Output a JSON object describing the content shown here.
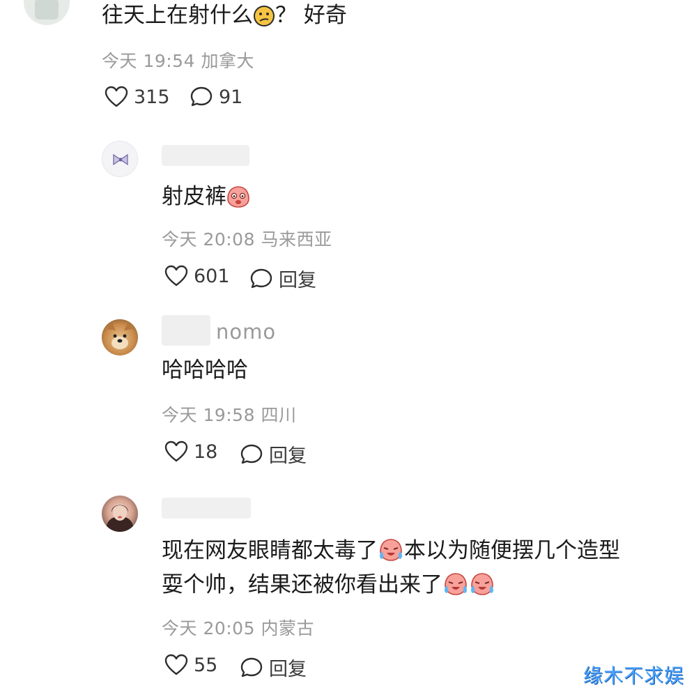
{
  "colors": {
    "text": "#1b1b1b",
    "meta": "#9a9a9a",
    "action": "#3a3a3a",
    "watermark": "#4aa0ff"
  },
  "comments": [
    {
      "text": "往天上在射什么",
      "text_after": "？ 好奇",
      "emoji": "confused-face-emoji",
      "meta": "今天 19:54 加拿大",
      "likes": "315",
      "replies": "91"
    },
    {
      "text": "射皮裤",
      "emoji": "blushing-face-emoji",
      "meta": "今天 20:08 马来西亚",
      "likes": "601",
      "reply_label": "回复"
    },
    {
      "username_suffix": "nomo",
      "text": "哈哈哈哈",
      "meta": "今天 19:58 四川",
      "likes": "18",
      "reply_label": "回复"
    },
    {
      "line1": "现在网友眼睛都太毒了",
      "line1_after": "本以为随便摆几个造型",
      "line2": "耍个帅，结果还被你看出来了",
      "emoji": "crying-laughing-emoji",
      "meta": "今天 20:05 内蒙古",
      "likes": "55",
      "reply_label": "回复"
    }
  ],
  "watermark": "缘木不求娱"
}
